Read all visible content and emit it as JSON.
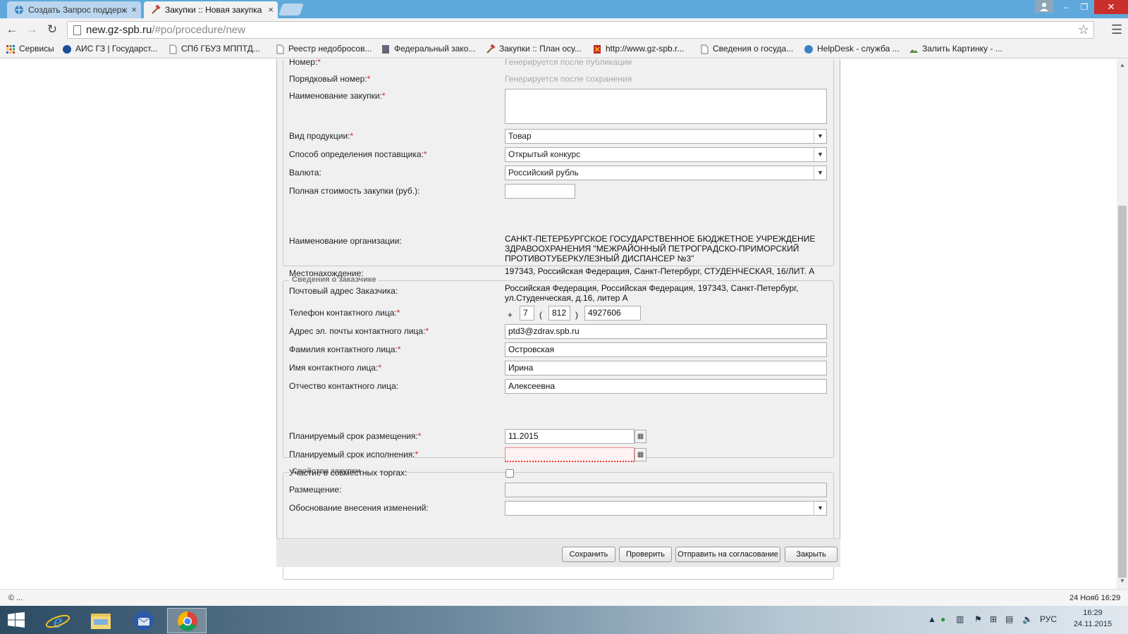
{
  "browser": {
    "tabs": [
      {
        "title": "Создать Запрос поддерж",
        "close": "×"
      },
      {
        "title": "Закупки :: Новая закупка",
        "close": "×"
      }
    ],
    "url_host": "new.gz-spb.ru",
    "url_path": "/#po/procedure/new",
    "window_controls": {
      "minimize": "–",
      "restore": "❐",
      "close": "✕"
    },
    "bookmarks": [
      "Сервисы",
      "АИС ГЗ | Государст...",
      "СПб ГБУЗ МППТД...",
      "Реестр недобросов...",
      "Федеральный зако...",
      "Закупки :: План осу...",
      "http://www.gz-spb.r...",
      "Сведения о госуда...",
      "HelpDesk - служба ...",
      "Залить Картинку - ..."
    ]
  },
  "form": {
    "number_label": "Номер:",
    "number_hint": "Генерируется после публикации",
    "seq_label": "Порядковый номер:",
    "seq_hint": "Генерируется после сохранения",
    "name_label": "Наименование закупки:",
    "name_value": "",
    "product_label": "Вид продукции:",
    "product_value": "Товар",
    "method_label": "Способ определения поставщика:",
    "method_value": "Открытый конкурс",
    "currency_label": "Валюта:",
    "currency_value": "Российский рубль",
    "cost_label": "Полная стоимость закупки (руб.):",
    "cost_value": "",
    "required_mark": "*"
  },
  "customer": {
    "legend": "Сведения о заказчике",
    "org_label": "Наименование организации:",
    "org_lines": [
      "САНКТ-ПЕТЕРБУРГСКОЕ ГОСУДАРСТВЕННОЕ БЮДЖЕТНОЕ УЧРЕЖДЕНИЕ",
      "ЗДРАВООХРАНЕНИЯ \"МЕЖРАЙОННЫЙ ПЕТРОГРАДСКО-ПРИМОРСКИЙ",
      "ПРОТИВОТУБЕРКУЛЕЗНЫЙ ДИСПАНСЕР №3\""
    ],
    "location_label": "Местонахождение:",
    "location_value": "197343, Российская Федерация, Санкт-Петербург, СТУДЕНЧЕСКАЯ, 16/ЛИТ. А",
    "postal_label": "Почтовый адрес Заказчика:",
    "postal_lines": [
      "Российская Федерация, Российская Федерация, 197343, Санкт-Петербург,",
      "ул.Студенческая, д.16, литер А"
    ],
    "phone_label": "Телефон контактного лица:",
    "phone_plus": "+",
    "phone_country": "7",
    "phone_open": "(",
    "phone_code": "812",
    "phone_close": ")",
    "phone_number": "4927606",
    "email_label": "Адрес эл. почты контактного лица:",
    "email_value": "ptd3@zdrav.spb.ru",
    "lastname_label": "Фамилия контактного лица:",
    "lastname_value": "Островская",
    "firstname_label": "Имя контактного лица:",
    "firstname_value": "Ирина",
    "middlename_label": "Отчество контактного лица:",
    "middlename_value": "Алексеевна"
  },
  "props": {
    "legend": "Свойства закупки",
    "placement_date_label": "Планируемый срок размещения:",
    "placement_date_value": "11.2015",
    "exec_date_label": "Планируемый срок исполнения:",
    "exec_date_value": "",
    "joint_label": "Участие в совместных торгах:",
    "joint_checked": false,
    "placement_label": "Размещение:",
    "placement_value": "",
    "reason_label": "Обоснование внесения изменений:",
    "reason_value": ""
  },
  "buttons": {
    "save": "Сохранить",
    "check": "Проверить",
    "send": "Отправить на согласование",
    "close": "Закрыть"
  },
  "statusbar": {
    "left": "© ...",
    "right": "24 Нояб 16:29"
  },
  "taskbar": {
    "lang": "РУС",
    "time": "16:29",
    "date": "24.11.2015"
  },
  "colors": {
    "titlebar": "#5fa8dc",
    "required": "#dd2222",
    "error_border": "#ee8888"
  }
}
